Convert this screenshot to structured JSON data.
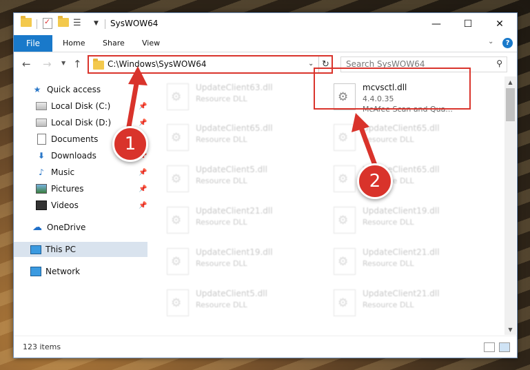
{
  "window": {
    "title": "SysWOW64",
    "controls": {
      "minimize": "—",
      "maximize": "☐",
      "close": "✕"
    }
  },
  "ribbon": {
    "file_tab": "File",
    "tabs": [
      "Home",
      "Share",
      "View"
    ]
  },
  "nav": {
    "address": "C:\\Windows\\SysWOW64",
    "search_placeholder": "Search SysWOW64"
  },
  "sidebar": {
    "items": [
      {
        "label": "Quick access",
        "icon": "star-icon"
      },
      {
        "label": "Local Disk (C:)",
        "icon": "drive-icon",
        "pinned": true
      },
      {
        "label": "Local Disk (D:)",
        "icon": "drive-icon",
        "pinned": true
      },
      {
        "label": "Documents",
        "icon": "documents-icon",
        "pinned": true
      },
      {
        "label": "Downloads",
        "icon": "downloads-icon",
        "pinned": true
      },
      {
        "label": "Music",
        "icon": "music-icon",
        "pinned": true
      },
      {
        "label": "Pictures",
        "icon": "pictures-icon",
        "pinned": true
      },
      {
        "label": "Videos",
        "icon": "videos-icon",
        "pinned": true
      },
      {
        "label": "OneDrive",
        "icon": "onedrive-icon"
      },
      {
        "label": "This PC",
        "icon": "this-pc-icon",
        "selected": true
      },
      {
        "label": "Network",
        "icon": "network-icon"
      }
    ]
  },
  "files": {
    "left": [
      {
        "name": "UpdateClient63.dll",
        "type": "Resource DLL"
      },
      {
        "name": "UpdateClient65.dll",
        "type": "Resource DLL"
      },
      {
        "name": "UpdateClient5.dll",
        "type": "Resource DLL"
      },
      {
        "name": "UpdateClient21.dll",
        "type": "Resource DLL"
      },
      {
        "name": "UpdateClient19.dll",
        "type": "Resource DLL"
      },
      {
        "name": "UpdateClient5.dll",
        "type": "Resource DLL"
      }
    ],
    "right": [
      {
        "name": "mcvsctl.dll",
        "version": "4.4.0.35",
        "description": "McAfee Scan and Qua..."
      },
      {
        "name": "UpdateClient65.dll",
        "type": "Resource DLL"
      },
      {
        "name": "UpdateClient65.dll",
        "type": "Resource DLL"
      },
      {
        "name": "UpdateClient19.dll",
        "type": "Resource DLL"
      },
      {
        "name": "UpdateClient21.dll",
        "type": "Resource DLL"
      },
      {
        "name": "UpdateClient21.dll",
        "type": "Resource DLL"
      }
    ]
  },
  "status": {
    "item_count": "123 items"
  },
  "annotations": {
    "badge1": "1",
    "badge2": "2",
    "color": "#d9332b"
  }
}
